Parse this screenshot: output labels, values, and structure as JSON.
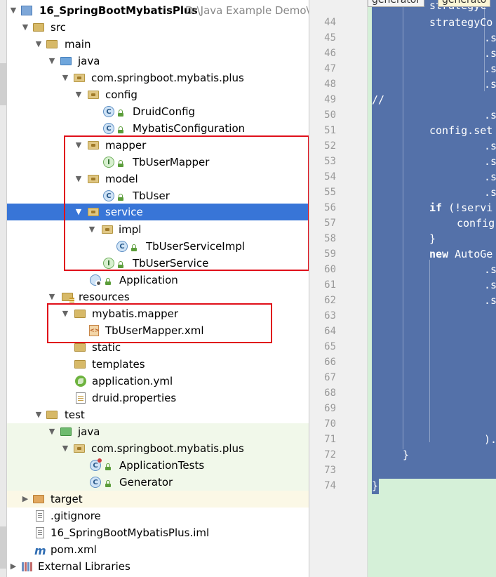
{
  "tree": [
    {
      "key": "project",
      "text": "16_SpringBootMybatisPlus",
      "path": "D:\\Java Example Demo\\Sp"
    },
    {
      "key": "src",
      "text": "src"
    },
    {
      "key": "main",
      "text": "main"
    },
    {
      "key": "java",
      "text": "java"
    },
    {
      "key": "pkg",
      "text": "com.springboot.mybatis.plus"
    },
    {
      "key": "config",
      "text": "config"
    },
    {
      "key": "druidconfig",
      "text": "DruidConfig"
    },
    {
      "key": "mybatisconfig",
      "text": "MybatisConfiguration"
    },
    {
      "key": "mapper",
      "text": "mapper"
    },
    {
      "key": "tbusermapper",
      "text": "TbUserMapper"
    },
    {
      "key": "model",
      "text": "model"
    },
    {
      "key": "tbuser",
      "text": "TbUser"
    },
    {
      "key": "service",
      "text": "service"
    },
    {
      "key": "impl",
      "text": "impl"
    },
    {
      "key": "tbuserserviceimpl",
      "text": "TbUserServiceImpl"
    },
    {
      "key": "tbuserservice",
      "text": "TbUserService"
    },
    {
      "key": "application",
      "text": "Application"
    },
    {
      "key": "resources",
      "text": "resources"
    },
    {
      "key": "mybatismapper",
      "text": "mybatis.mapper"
    },
    {
      "key": "tbusermapperxml",
      "text": "TbUserMapper.xml"
    },
    {
      "key": "static",
      "text": "static"
    },
    {
      "key": "templates",
      "text": "templates"
    },
    {
      "key": "applicationyml",
      "text": "application.yml"
    },
    {
      "key": "druidprops",
      "text": "druid.properties"
    },
    {
      "key": "test",
      "text": "test"
    },
    {
      "key": "testjava",
      "text": "java"
    },
    {
      "key": "testpkg",
      "text": "com.springboot.mybatis.plus"
    },
    {
      "key": "applicationtests",
      "text": "ApplicationTests"
    },
    {
      "key": "generator",
      "text": "Generator"
    },
    {
      "key": "target",
      "text": "target"
    },
    {
      "key": "gitignore",
      "text": ".gitignore"
    },
    {
      "key": "iml",
      "text": "16_SpringBootMybatisPlus.iml"
    },
    {
      "key": "pom",
      "text": "pom.xml"
    },
    {
      "key": "extlibs",
      "text": "External Libraries"
    }
  ],
  "tabs": [
    "generator",
    "generato"
  ],
  "gutter_lines": [
    "44",
    "45",
    "46",
    "47",
    "48",
    "49",
    "50",
    "51",
    "52",
    "53",
    "54",
    "55",
    "56",
    "57",
    "58",
    "59",
    "60",
    "61",
    "62",
    "63",
    "64",
    "65",
    "66",
    "67",
    "68",
    "69",
    "70",
    "71",
    "72",
    "73",
    "74"
  ],
  "code_lines": [
    "strategyCo",
    ".s",
    ".s",
    ".s",
    ".s",
    "//",
    ".s",
    "config.set",
    ".s",
    ".s",
    ".s",
    ".s",
    "if (!servi",
    "config",
    "}",
    "new AutoGe",
    ".s",
    ".s",
    ".s",
    "",
    "",
    "",
    "",
    "",
    "",
    "",
    "",
    ").",
    "}",
    "",
    "}"
  ],
  "code_top_partial": "strategyC",
  "colors": {
    "selection": "#3875d7",
    "editor_selection": "#5471a9",
    "annotation_box": "#e0101a",
    "editor_bg": "#d5f0d8"
  }
}
